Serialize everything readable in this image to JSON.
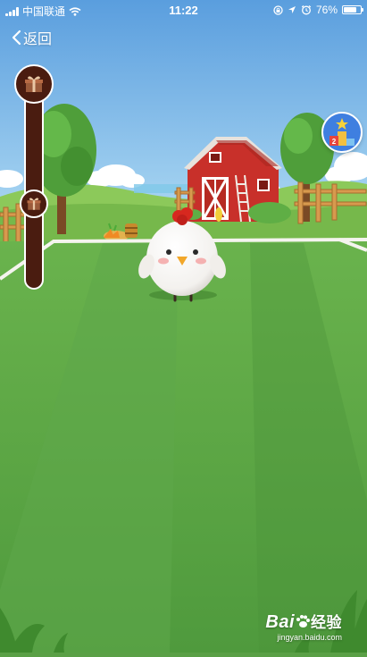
{
  "status_bar": {
    "carrier": "中国联通",
    "time": "11:22",
    "battery_percent": "76%",
    "battery_level": 0.76,
    "icons": [
      "signal-icon",
      "wifi-icon",
      "screen-lock-icon",
      "location-arrow-icon",
      "alarm-icon",
      "battery-icon"
    ]
  },
  "nav": {
    "back_label": "返回",
    "back_icon": "chevron-left-icon"
  },
  "progress_tracker": {
    "icons": [
      "gift-box-icon",
      "gift-box-icon"
    ]
  },
  "leaderboard": {
    "icon": "podium-star-icon",
    "podium_rank": "2"
  },
  "scene": {
    "elements": [
      "sky",
      "clouds",
      "red-barn",
      "trees",
      "wooden-fence",
      "haystack",
      "carrots",
      "grass-field",
      "white-chicken"
    ],
    "colors": {
      "sky": "#6fb3e8",
      "grass": "#5aa046",
      "barn": "#c8302a",
      "chicken": "#ffffff",
      "track": "#4a1c10"
    }
  },
  "watermark": {
    "brand_latin": "Bai",
    "brand_cn": "经验",
    "url": "jingyan.baidu.com"
  }
}
